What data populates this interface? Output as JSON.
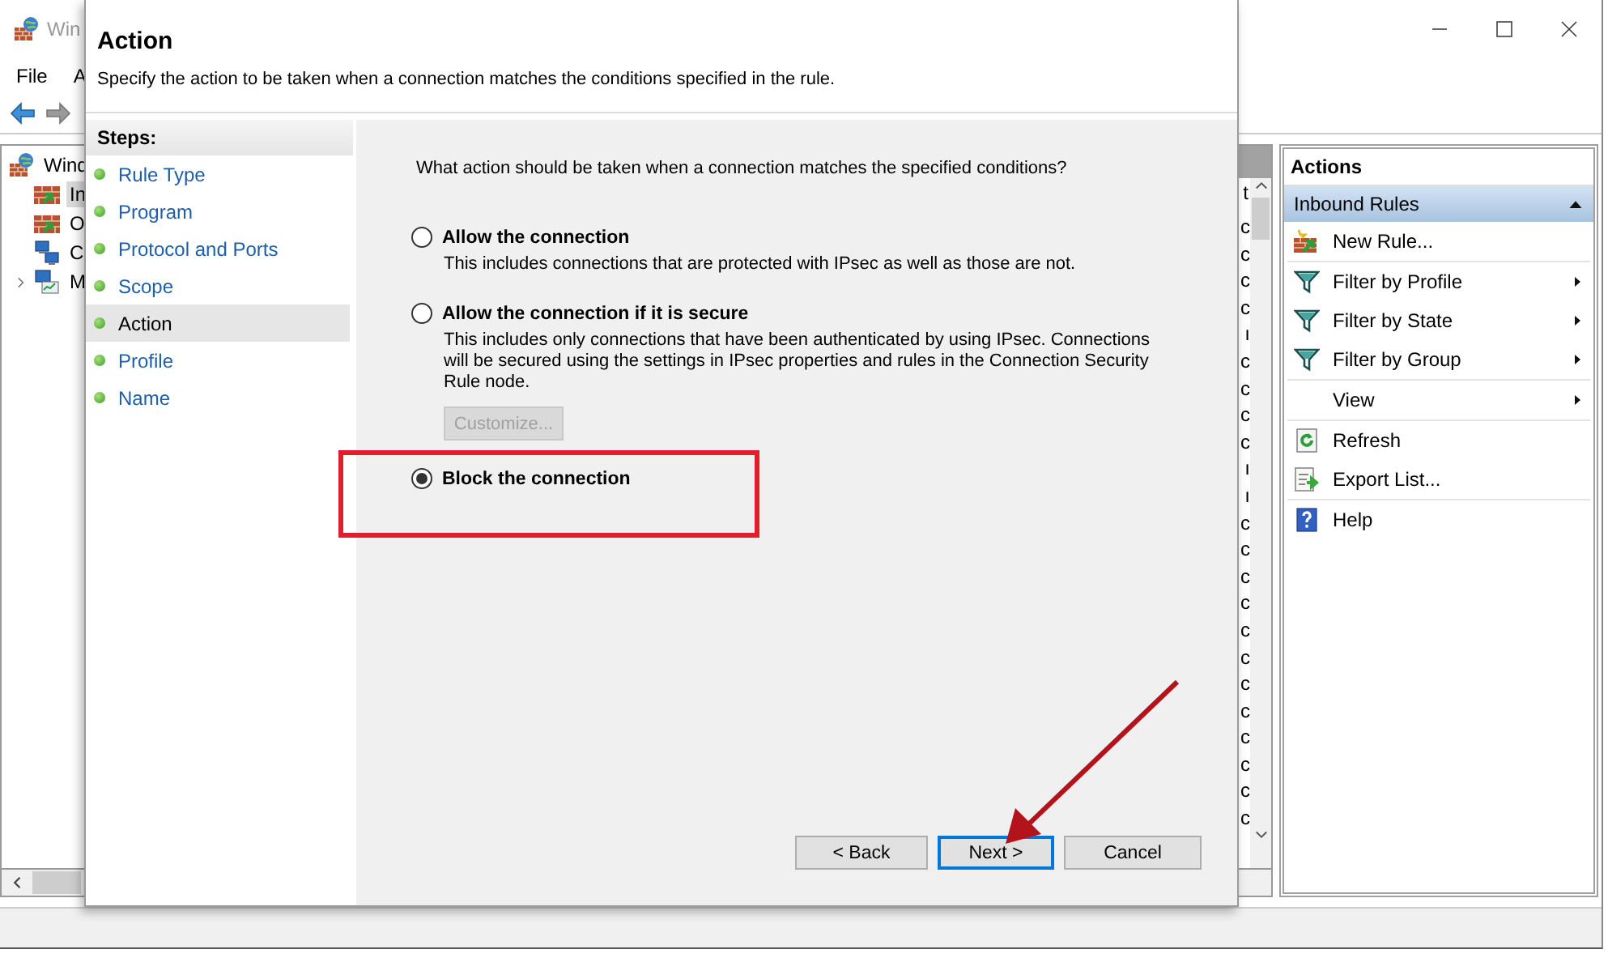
{
  "main_window": {
    "title": "Win",
    "menu": [
      "File",
      "A"
    ],
    "tree": [
      {
        "label": "Wind",
        "selected": false,
        "children": [
          {
            "label": "In",
            "selected": true
          },
          {
            "label": "O",
            "selected": false
          },
          {
            "label": "C",
            "selected": false
          },
          {
            "label": "M",
            "selected": false,
            "expanded": false
          }
        ]
      }
    ],
    "list": {
      "column_1": "t",
      "rows": [
        "c",
        "c",
        "c",
        "c",
        "ı",
        "c",
        "c",
        "c",
        "c",
        "ı",
        "ı",
        "c",
        "c",
        "c",
        "c",
        "c",
        "c",
        "c",
        "c",
        "c",
        "c",
        "c",
        "c"
      ]
    },
    "actions": {
      "title": "Actions",
      "section": {
        "label": "Inbound Rules",
        "expanded": true
      },
      "groups": [
        [
          {
            "label": "New Rule...",
            "submenu": false
          }
        ],
        [
          {
            "label": "Filter by Profile",
            "submenu": true
          },
          {
            "label": "Filter by State",
            "submenu": true
          },
          {
            "label": "Filter by Group",
            "submenu": true
          }
        ],
        [
          {
            "label": "View",
            "submenu": true
          }
        ],
        [
          {
            "label": "Refresh",
            "submenu": false
          },
          {
            "label": "Export List...",
            "submenu": false
          }
        ],
        [
          {
            "label": "Help",
            "submenu": false
          }
        ]
      ]
    }
  },
  "dialog": {
    "title": "Action",
    "subtitle": "Specify the action to be taken when a connection matches the conditions specified in the rule.",
    "steps_title": "Steps:",
    "steps": [
      {
        "label": "Rule Type",
        "selected": false
      },
      {
        "label": "Program",
        "selected": false
      },
      {
        "label": "Protocol and Ports",
        "selected": false
      },
      {
        "label": "Scope",
        "selected": false
      },
      {
        "label": "Action",
        "selected": true
      },
      {
        "label": "Profile",
        "selected": false
      },
      {
        "label": "Name",
        "selected": false
      }
    ],
    "question": "What action should be taken when a connection matches the specified conditions?",
    "options": [
      {
        "label": "Allow the connection",
        "selected": false,
        "description": "This includes connections that are protected with IPsec as well as those are not."
      },
      {
        "label": "Allow the connection if it is secure",
        "selected": false,
        "description": "This includes only connections that have been authenticated by using IPsec.  Connections will be secured using the settings in IPsec properties and rules in the Connection Security Rule node.",
        "button": {
          "label": "Customize...",
          "disabled": true
        }
      },
      {
        "label": "Block the connection",
        "selected": true
      }
    ],
    "buttons": [
      {
        "label": "< Back",
        "focused": false
      },
      {
        "label": "Next >",
        "focused": true
      },
      {
        "label": "Cancel",
        "focused": false
      }
    ]
  },
  "annotations": {
    "highlight_box": true,
    "pointer_arrow": true
  }
}
